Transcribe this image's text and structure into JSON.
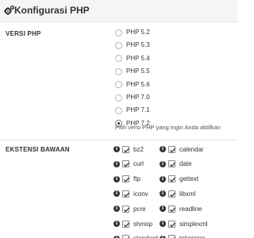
{
  "header": {
    "title": "Konfigurasi PHP",
    "icon": "gears-icon"
  },
  "php_version": {
    "label": "VERSI PHP",
    "options": [
      "PHP 5.2",
      "PHP 5.3",
      "PHP 5.4",
      "PHP 5.5",
      "PHP 5.6",
      "PHP 7.0",
      "PHP 7.1",
      "PHP 7.2"
    ],
    "selected": "PHP 7.2",
    "help": "Pilih versi PHP yang ingin Anda aktifkan"
  },
  "extensions": {
    "label": "EKSTENSI BAWAAN",
    "left": [
      {
        "name": "bz2",
        "checked": true
      },
      {
        "name": "curl",
        "checked": true
      },
      {
        "name": "ftp",
        "checked": true
      },
      {
        "name": "iconv",
        "checked": true
      },
      {
        "name": "pcre",
        "checked": true
      },
      {
        "name": "shmop",
        "checked": true
      },
      {
        "name": "standard",
        "checked": true
      }
    ],
    "right": [
      {
        "name": "calendar",
        "checked": true
      },
      {
        "name": "date",
        "checked": true
      },
      {
        "name": "gettext",
        "checked": true
      },
      {
        "name": "libxml",
        "checked": true
      },
      {
        "name": "readline",
        "checked": true
      },
      {
        "name": "simplexml",
        "checked": true
      },
      {
        "name": "tokenizer",
        "checked": true
      }
    ]
  }
}
